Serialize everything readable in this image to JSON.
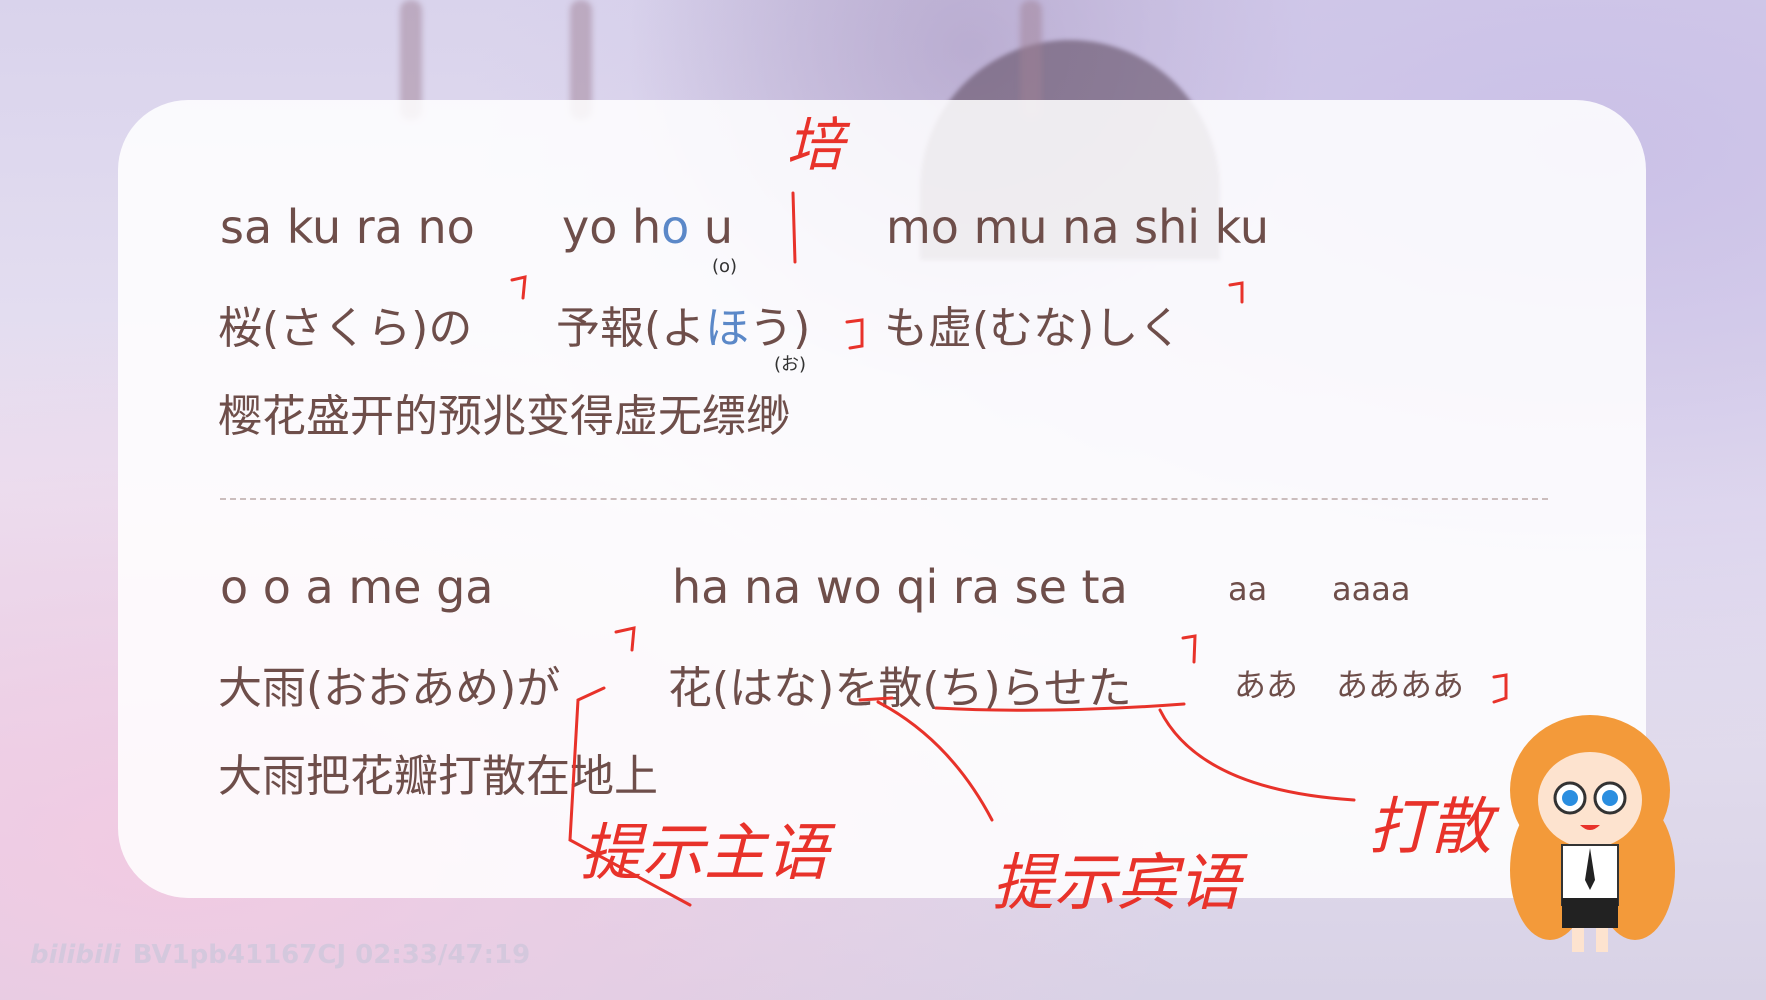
{
  "block1": {
    "romaji": {
      "seg1": "sa ku ra no",
      "seg2_pre": "yo h",
      "seg2_hl": "o",
      "seg2_post": " u",
      "seg2_note": "(o)",
      "seg3": "mo mu na shi ku"
    },
    "kana": {
      "seg1": "桜(さくら)の",
      "seg2_pre": "予報(よ",
      "seg2_hl": "ほ",
      "seg2_post": "う)",
      "seg2_note": "(お)",
      "seg3": "も虚(むな)しく"
    },
    "translation": "樱花盛开的预兆变得虚无缥缈"
  },
  "block2": {
    "romaji": {
      "seg1": "o o a me ga",
      "seg2": "ha na wo qi ra se ta",
      "seg3": "aa",
      "seg4": "aaaa"
    },
    "kana": {
      "seg1": "大雨(おおあめ)が",
      "seg2": "花(はな)を散(ち)らせた",
      "seg3": "ああ",
      "seg4": "ああああ"
    },
    "translation": "大雨把花瓣打散在地上"
  },
  "annotations": {
    "top": "培",
    "subject": "提示主语",
    "object": "提示宾语",
    "scatter": "打散"
  },
  "watermark": {
    "code": "BV1pb41167CJ 02:33/47:19",
    "logo": "bilibili"
  },
  "colors": {
    "text": "#6e4e4a",
    "highlight": "#5b88c8",
    "ink": "#e8322a"
  }
}
